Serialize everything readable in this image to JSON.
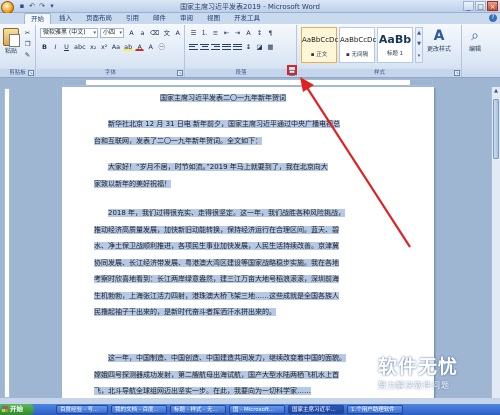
{
  "window": {
    "title": "国家主席习近平发表2019 - Microsoft Word",
    "minimize": "_",
    "maximize": "□",
    "close": "×"
  },
  "tabs": [
    {
      "label": "开始",
      "active": true
    },
    {
      "label": "插入"
    },
    {
      "label": "页面布局"
    },
    {
      "label": "引用"
    },
    {
      "label": "邮件"
    },
    {
      "label": "审阅"
    },
    {
      "label": "视图"
    },
    {
      "label": "开发工具"
    }
  ],
  "ribbon": {
    "clipboard": {
      "paste_label": "粘贴",
      "group_label": "剪贴板"
    },
    "font": {
      "font_name": "微软雅黑 (中文)",
      "font_size": "小四",
      "group_label": "字体"
    },
    "paragraph": {
      "group_label": "段落"
    },
    "styles": {
      "group_label": "样式",
      "items": [
        {
          "sample": "AaBbCcDc",
          "name": "▪ 正文"
        },
        {
          "sample": "AaBbCcDc",
          "name": "▪ 无间隔"
        },
        {
          "sample": "AaBb",
          "name": "标题 1"
        }
      ],
      "change_styles_label": "更改样式"
    },
    "editing": {
      "label": "编辑"
    }
  },
  "document": {
    "lines": [
      "国家主席习近平发表二〇一九年新年贺词",
      "新华社北京 12 月 31 日电  新年前夕，国家主席习近平通过中央广播电视总",
      "台和互联网，发表了二〇一九年新年贺词。全文如下：",
      "大家好！“岁月不居，时节如流。”2019 年马上就要到了，我在北京向大",
      "家致以新年的美好祝福！",
      "2018 年，我们过得很充实、走得很坚定。这一年，我们战胜各种风险挑战，",
      "推动经济高质量发展，加快新旧动能转换，保持经济运行在合理区间。蓝天、碧",
      "水、净土保卫战顺利推进，各项民生事业加快发展，人民生活持续改善。京津冀",
      "协同发展、长江经济带发展、粤港澳大湾区建设等国家战略稳步实施。我在各地",
      "考察时欣喜地看到：长江两岸绿意盎然，建三江万亩大地号稻浪滚滚，深圳前海",
      "生机勃勃，上海张江活力四射，港珠澳大桥飞架三地……这些成就是全国各族人",
      "民撸起袖子干出来的，是新时代奋斗者挥洒汗水拼出来的。",
      "这一年，中国制造、中国创造、中国建造共同发力，继续改变着中国的面貌。",
      "嫦娥四号探测器成功发射，第二艘航母出海试航，国产大型水陆两栖飞机水上首",
      "飞，北斗导航全球组网迈出坚实一步。在此，我要向为一切科学家……"
    ]
  },
  "taskbar": {
    "start_label": "开始",
    "items": [
      "百度经验 - 写...",
      "我的文档 - 百度...",
      "标题 - 样式 - 无...",
      "国 - Microsoft...",
      "国家主席习近平...",
      "1.个用户助理软件"
    ]
  },
  "watermark": {
    "logo": "软件无忧",
    "sub": "努力解决软件问题"
  }
}
